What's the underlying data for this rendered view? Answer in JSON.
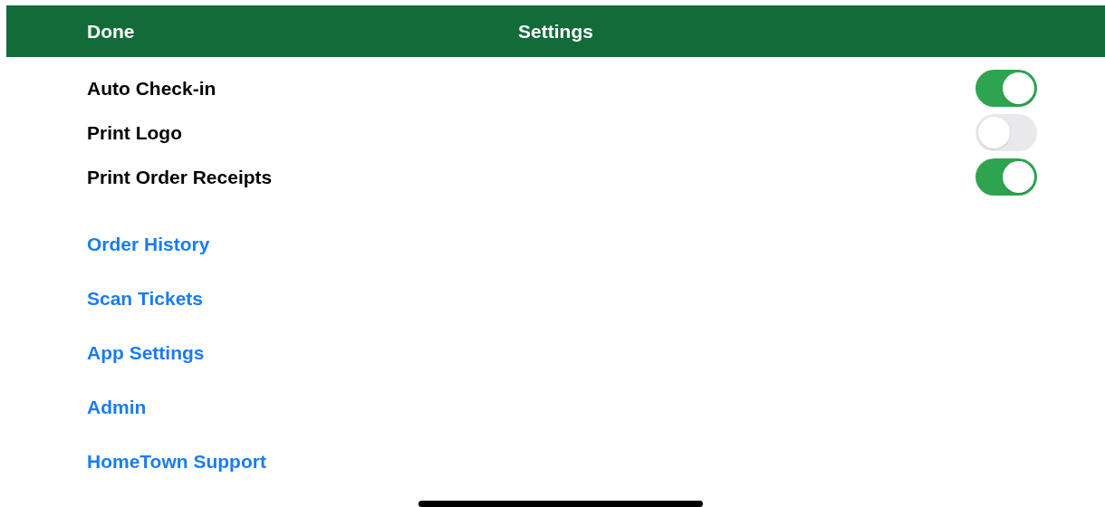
{
  "nav_bar": {
    "left_button": "Done",
    "title": "Settings"
  },
  "toggles": [
    {
      "label": "Auto Check-in",
      "on": true
    },
    {
      "label": "Print Logo",
      "on": false
    },
    {
      "label": "Print Order Receipts",
      "on": true
    }
  ],
  "links": [
    "Order History",
    "Scan Tickets",
    "App Settings",
    "Admin",
    "HomeTown Support"
  ]
}
